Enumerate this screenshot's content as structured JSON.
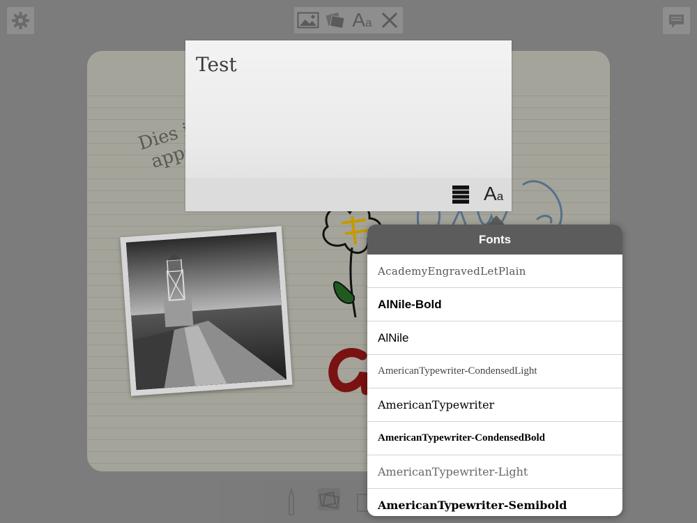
{
  "toolbar": {
    "settings_icon": "gear-icon",
    "tools": [
      "image-icon",
      "photos-icon",
      "font-icon",
      "close-icon"
    ],
    "comment_icon": "comment-icon",
    "font_glyph_big": "A",
    "font_glyph_small": "a"
  },
  "notebook": {
    "script_line1": "Dies i",
    "script_line2": "appg"
  },
  "text_card": {
    "text": "Test",
    "list_icon": "list-style-icon",
    "font_icon": "font-icon"
  },
  "fonts_popover": {
    "title": "Fonts",
    "fonts": [
      "AcademyEngravedLetPlain",
      "AlNile-Bold",
      "AlNile",
      "AmericanTypewriter-CondensedLight",
      "AmericanTypewriter",
      "AmericanTypewriter-CondensedBold",
      "AmericanTypewriter-Light",
      "AmericanTypewriter-Semibold"
    ]
  },
  "colors": {
    "background": "#7c7c7c",
    "notebook": "#a4a49a",
    "popover_header": "#5c5c5c",
    "ink_red": "#7a1212",
    "ink_green": "#1f5a1f",
    "ink_yellow": "#c49a00",
    "ink_blue": "#56708a"
  }
}
